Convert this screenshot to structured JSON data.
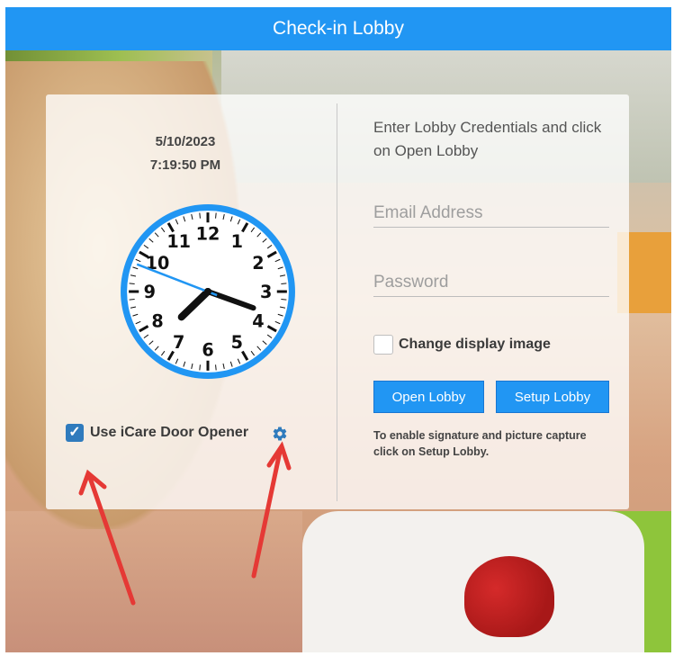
{
  "header": {
    "title": "Check-in Lobby"
  },
  "clock": {
    "date": "5/10/2023",
    "time": "7:19:50 PM",
    "numbers": [
      "12",
      "1",
      "2",
      "3",
      "4",
      "5",
      "6",
      "7",
      "8",
      "9",
      "10",
      "11"
    ]
  },
  "door_opener": {
    "label": "Use iCare Door Opener",
    "checked": true
  },
  "login": {
    "instructions": "Enter Lobby Credentials and click on Open Lobby",
    "email_placeholder": "Email Address",
    "password_placeholder": "Password",
    "change_image_label": "Change display image",
    "open_button": "Open Lobby",
    "setup_button": "Setup Lobby",
    "note": "To enable signature and picture capture click on Setup Lobby."
  },
  "colors": {
    "header": "#2196f3",
    "button": "#2196f3",
    "clock_ring": "#2196f3",
    "arrow": "#e53935"
  }
}
